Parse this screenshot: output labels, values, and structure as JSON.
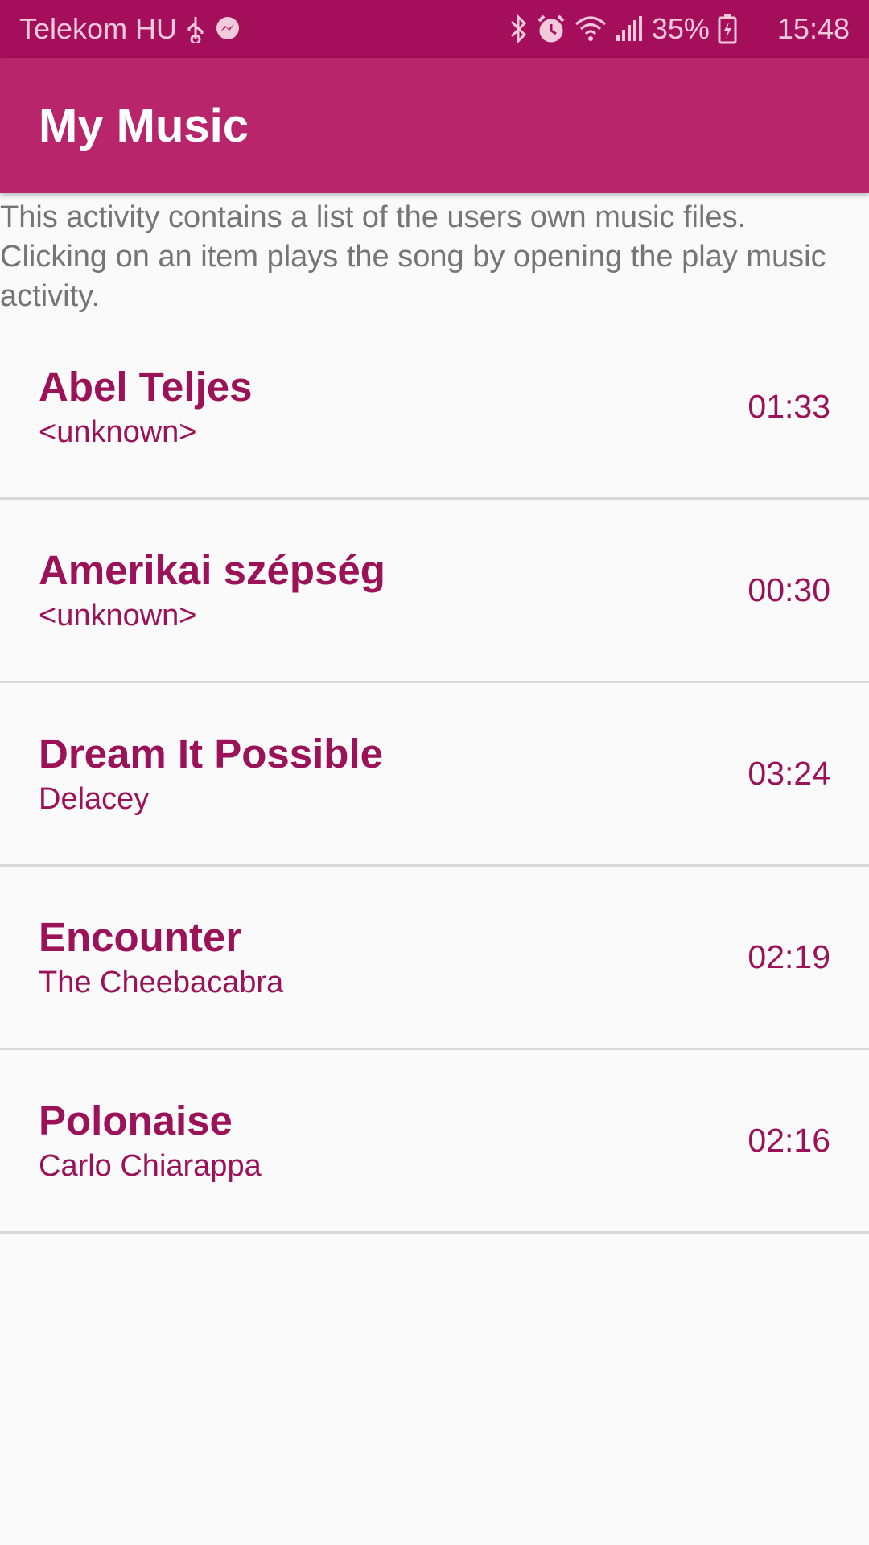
{
  "status_bar": {
    "carrier": "Telekom HU",
    "battery": "35%",
    "time": "15:48",
    "icons": [
      "usb-icon",
      "messenger-icon",
      "bluetooth-icon",
      "alarm-icon",
      "wifi-icon",
      "signal-icon",
      "battery-charging-icon"
    ]
  },
  "app_bar": {
    "title": "My Music"
  },
  "description": "This activity contains a list of the users own music files. Clicking on an item plays the song by opening the play music activity.",
  "songs": [
    {
      "title": "Abel Teljes",
      "artist": "<unknown>",
      "duration": "01:33"
    },
    {
      "title": "Amerikai szépség",
      "artist": "<unknown>",
      "duration": "00:30"
    },
    {
      "title": "Dream It Possible",
      "artist": "Delacey",
      "duration": "03:24"
    },
    {
      "title": "Encounter",
      "artist": "The Cheebacabra",
      "duration": "02:19"
    },
    {
      "title": "Polonaise",
      "artist": "Carlo Chiarappa",
      "duration": "02:16"
    }
  ],
  "colors": {
    "status_bar": "#a50e5b",
    "app_bar": "#b8256b",
    "accent_text": "#9c1259",
    "background": "#fafafa"
  }
}
